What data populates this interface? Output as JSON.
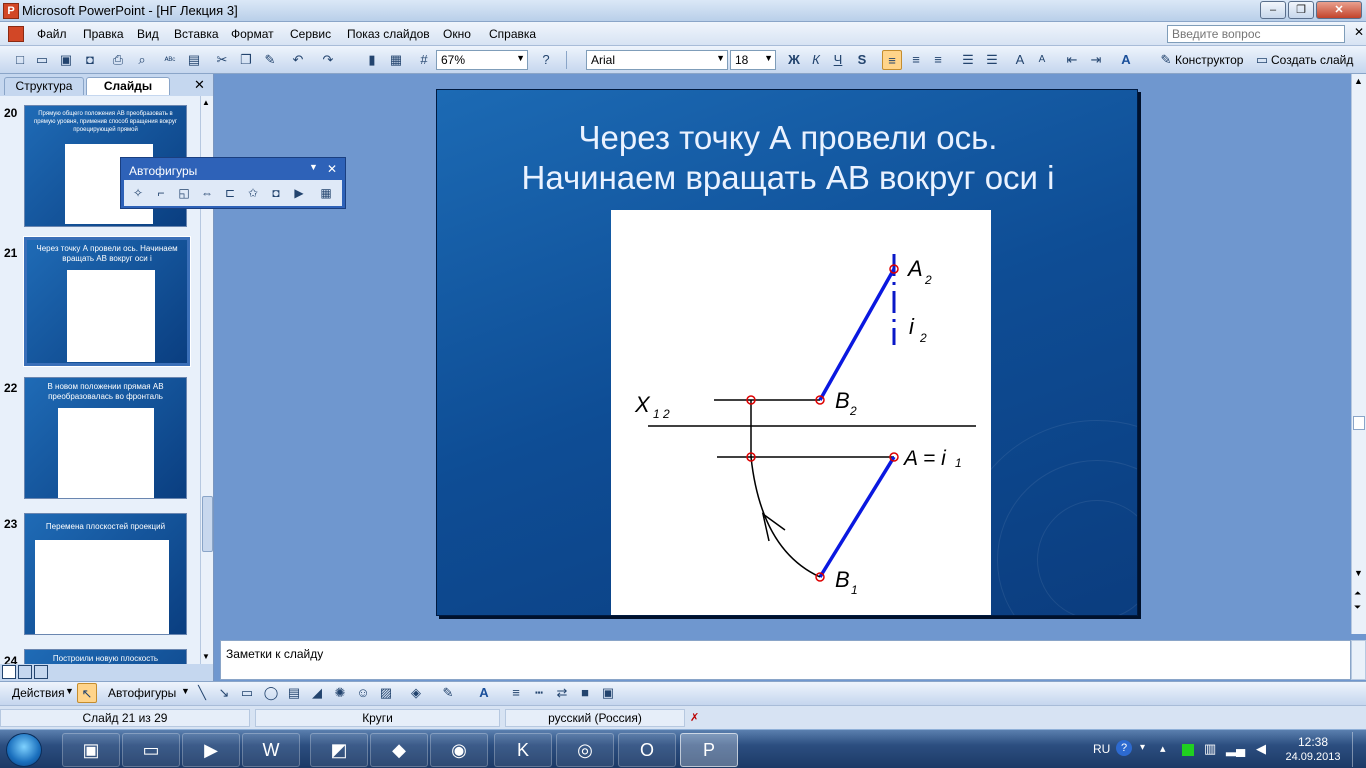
{
  "window": {
    "title": "Microsoft PowerPoint - [НГ Лекция 3]",
    "minimize": "–",
    "restore": "❐",
    "close": "✕"
  },
  "menu": [
    "Файл",
    "Правка",
    "Вид",
    "Вставка",
    "Формат",
    "Сервис",
    "Показ слайдов",
    "Окно",
    "Справка"
  ],
  "help_search": {
    "placeholder": "Введите вопрос"
  },
  "toolbar": {
    "zoom": "67%",
    "font": "Arial",
    "font_size": "18",
    "bold": "Ж",
    "italic": "К",
    "underline": "Ч",
    "shadow": "S",
    "designer": "Конструктор",
    "new_slide": "Создать слайд"
  },
  "left_pane": {
    "tabs": [
      "Структура",
      "Слайды"
    ],
    "close": "✕",
    "thumbnails": [
      {
        "num": "20",
        "title": "Прямую общего положения АВ преобразовать в прямую уровня, применив способ вращения вокруг проецирующей прямой"
      },
      {
        "num": "21",
        "title": "Через точку А провели ось. Начинаем вращать АВ вокруг оси i",
        "selected": true
      },
      {
        "num": "22",
        "title": "В новом положении прямая АВ преобразовалась во фронталь"
      },
      {
        "num": "23",
        "title": "Перемена плоскостей проекций"
      },
      {
        "num": "24",
        "title": "Построили новую плоскость"
      }
    ]
  },
  "autofigures_toolbar": {
    "title": "Автофигуры",
    "close": "✕"
  },
  "slide": {
    "title_line1": "Через точку А провели ось.",
    "title_line2": "Начинаем вращать АВ вокруг оси i",
    "labels": {
      "A2": "A",
      "A2_sub": "2",
      "i2": "i",
      "i2_sub": "2",
      "B2": "B",
      "B2_sub": "2",
      "X12": "X",
      "X12_sub": "1 2",
      "Ai1": "A = i",
      "Ai1_sub": "1",
      "B1": "B",
      "B1_sub": "1"
    }
  },
  "notes": {
    "placeholder": "Заметки к слайду"
  },
  "drawing_toolbar": {
    "actions": "Действия",
    "autoshapes": "Автофигуры"
  },
  "status": {
    "slide": "Слайд 21 из 29",
    "design": "Круги",
    "language": "русский (Россия)"
  },
  "taskbar": {
    "lang": "RU",
    "time": "12:38",
    "date": "24.09.2013"
  }
}
